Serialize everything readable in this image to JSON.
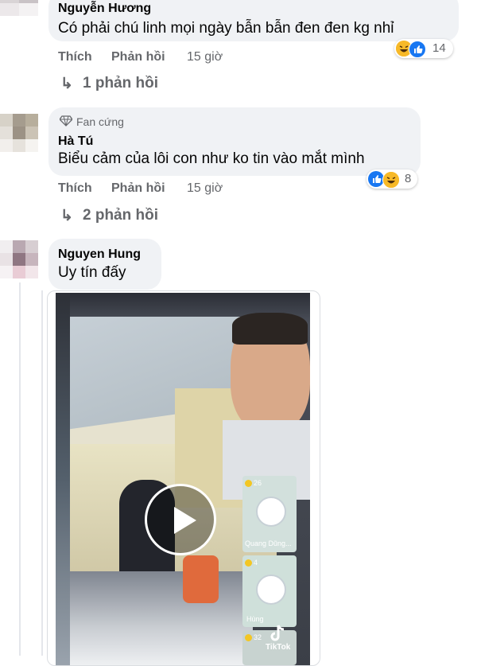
{
  "comments": [
    {
      "author": "Nguyễn Hương",
      "text": "Có phải chú linh mọi ngày bẫn bẫn đen đen kg nhỉ",
      "like": "Thích",
      "reply": "Phản hồi",
      "time": "15 giờ",
      "reaction_count": "14",
      "reactions": [
        "haha",
        "like"
      ],
      "replies_label": "1 phản hồi"
    },
    {
      "badge": "Fan cứng",
      "author": "Hà Tú",
      "text": "Biểu cảm của lôi con như ko tin vào mắt mình",
      "like": "Thích",
      "reply": "Phản hồi",
      "time": "15 giờ",
      "reaction_count": "8",
      "reactions": [
        "like",
        "haha"
      ],
      "replies_label": "2 phản hồi"
    },
    {
      "author": "Nguyen Hung",
      "text": "Uy tín đấy"
    }
  ],
  "video": {
    "thumbnail_tiles": [
      {
        "count": "26",
        "name": "Quang Dũng..."
      },
      {
        "count": "4",
        "name": "Hùng"
      },
      {
        "count": "32",
        "name": ""
      }
    ],
    "watermark": "TikTok",
    "play_icon": "play-icon"
  }
}
